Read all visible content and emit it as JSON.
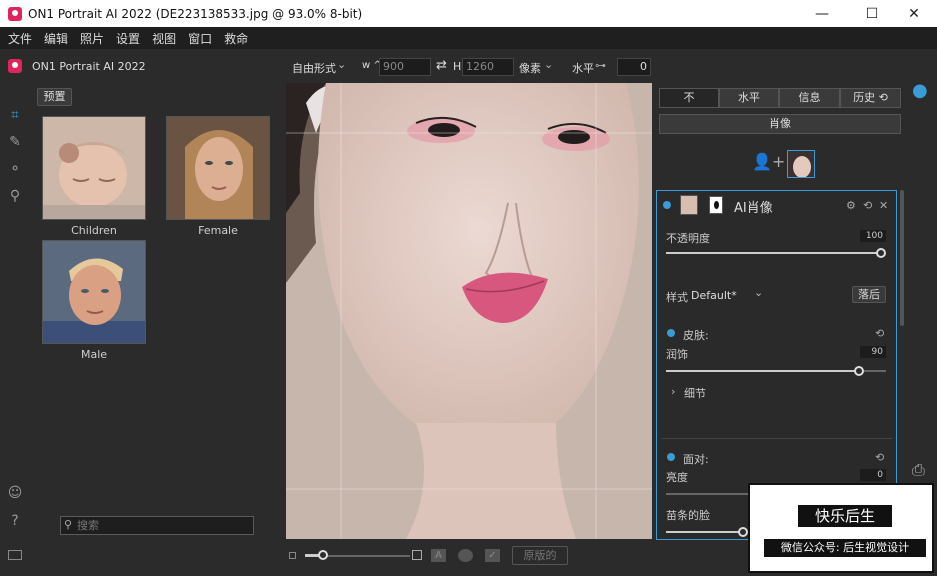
{
  "window": {
    "title": "ON1 Portrait AI 2022 (DE223138533.jpg @ 93.0% 8-bit)",
    "minimize": "—",
    "maximize": "☐",
    "close": "✕"
  },
  "menu": [
    "文件",
    "编辑",
    "照片",
    "设置",
    "视图",
    "窗口",
    "救命"
  ],
  "toolbar": {
    "app_name": "ON1 Portrait AI 2022",
    "crop_mode": "自由形式",
    "w_label": "w ^",
    "w_value": "900",
    "h_label": "H",
    "h_value": "1260",
    "unit": "像素",
    "level_label": "水平",
    "level_value": "0"
  },
  "browser": {
    "preset_button": "预置",
    "thumbs": [
      {
        "label": "Children",
        "color": "#b89886"
      },
      {
        "label": "Female",
        "color": "#a67a5a"
      },
      {
        "label": "Male",
        "color": "#b88f70"
      }
    ],
    "search_placeholder": "搜索"
  },
  "canvas_bottom": {
    "original_button": "原版的"
  },
  "right_tabs": [
    "不",
    "水平",
    "信息",
    "历史 ⟲"
  ],
  "portrait_button": "肖像",
  "ai": {
    "title": "AI肖像",
    "opacity_label": "不透明度",
    "opacity_value": "100",
    "style_label": "样式",
    "style_value": "Default*",
    "fallback_button": "落后",
    "skin_label": "皮肤:",
    "smooth_label": "润饰",
    "smooth_value": "90",
    "detail_label": "细节",
    "face_label": "面对:",
    "brightness_label": "亮度",
    "brightness_value": "0",
    "slim_label": "苗条的脸"
  },
  "watermark": {
    "line1": "快乐后生",
    "line2": "微信公众号: 后生视觉设计"
  },
  "colors": {
    "accent": "#3a9bd5",
    "brand": "#e0245e"
  }
}
